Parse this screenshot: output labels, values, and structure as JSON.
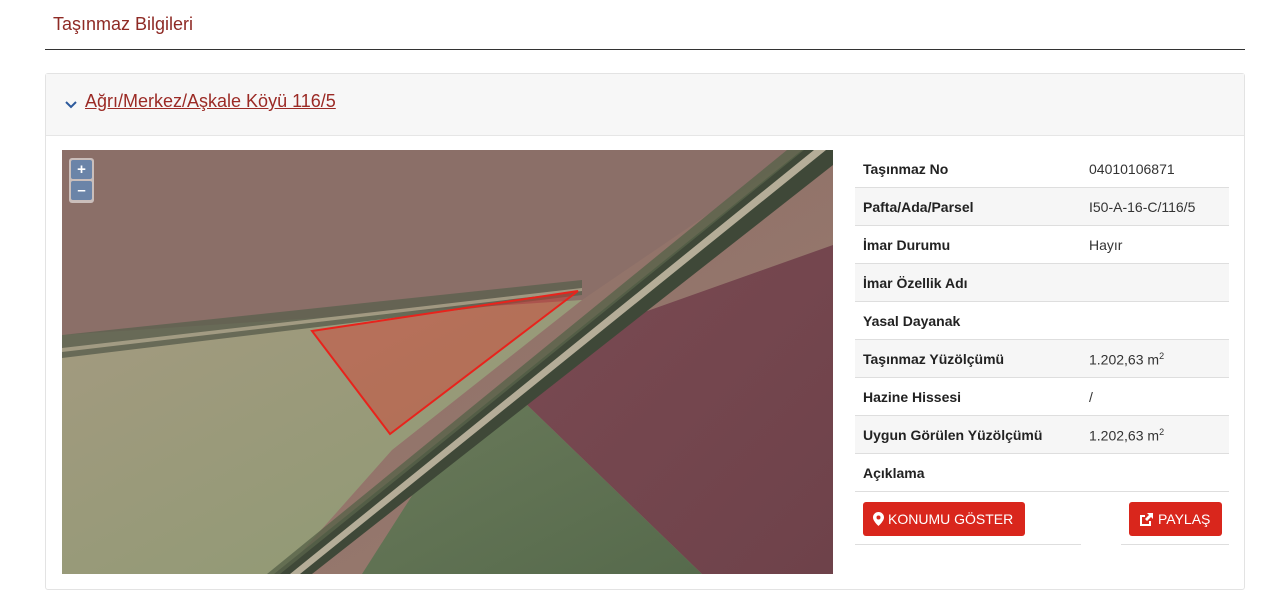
{
  "page": {
    "title": "Taşınmaz Bilgileri"
  },
  "panel": {
    "heading": "Ağrı/Merkez/Aşkale Köyü 116/5"
  },
  "map": {
    "zoom_in": "+",
    "zoom_out": "–"
  },
  "property": {
    "rows": [
      {
        "label": "Taşınmaz No",
        "value": "04010106871"
      },
      {
        "label": "Pafta/Ada/Parsel",
        "value": "I50-A-16-C/116/5"
      },
      {
        "label": "İmar Durumu",
        "value": "Hayır"
      },
      {
        "label": "İmar Özellik Adı",
        "value": ""
      },
      {
        "label": "Yasal Dayanak",
        "value": ""
      },
      {
        "label": "Taşınmaz Yüzölçümü",
        "value": "1.202,63 m",
        "unit_sup": "2"
      },
      {
        "label": "Hazine Hissesi",
        "value": "/"
      },
      {
        "label": "Uygun Görülen Yüzölçümü",
        "value": "1.202,63 m",
        "unit_sup": "2"
      },
      {
        "label": "Açıklama",
        "value": ""
      }
    ]
  },
  "actions": {
    "show_location": "KONUMU GÖSTER",
    "share": "PAYLAŞ"
  },
  "colors": {
    "accent": "#d9261c",
    "title": "#8e2a25",
    "parcel": "#e8231c"
  }
}
